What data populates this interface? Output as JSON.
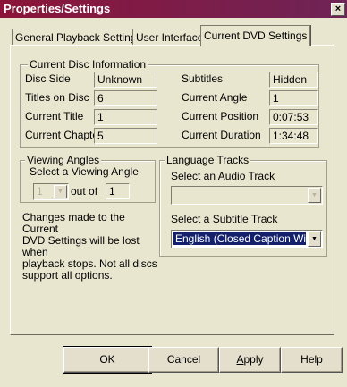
{
  "window": {
    "title": "Properties/Settings",
    "close": "×"
  },
  "tabs": [
    {
      "label": "General Playback Settings"
    },
    {
      "label": "User Interface"
    },
    {
      "label": "Current DVD Settings"
    }
  ],
  "disc_info": {
    "legend": "Current Disc Information",
    "rows": [
      {
        "label": "Disc Side",
        "value": "Unknown"
      },
      {
        "label": "Titles on Disc",
        "value": "6"
      },
      {
        "label": "Current Title",
        "value": "1"
      },
      {
        "label": "Current Chapter",
        "value": "5"
      },
      {
        "label": "Subtitles",
        "value": "Hidden"
      },
      {
        "label": "Current Angle",
        "value": "1"
      },
      {
        "label": "Current Position",
        "value": "0:07:53"
      },
      {
        "label": "Current Duration",
        "value": "1:34:48"
      }
    ]
  },
  "viewing_angles": {
    "legend": "Viewing Angles",
    "prompt": "Select a Viewing Angle",
    "selected": "1",
    "out_of_label": "out of",
    "total": "1"
  },
  "language_tracks": {
    "legend": "Language Tracks",
    "audio_prompt": "Select an Audio Track",
    "audio_value": "",
    "subtitle_prompt": "Select a Subtitle Track",
    "subtitle_value": "English (Closed Caption With Norm"
  },
  "note": {
    "line1": "Changes made to the Current",
    "line2": "DVD Settings will be lost when",
    "line3": "playback stops. Not all discs",
    "line4": "support all options."
  },
  "buttons": {
    "ok": "OK",
    "cancel": "Cancel",
    "apply_prefix": "A",
    "apply_rest": "pply",
    "help": "Help"
  },
  "colors": {
    "title_bar": "#8a1538",
    "face": "#e9e6d0",
    "selection": "#14206b"
  }
}
